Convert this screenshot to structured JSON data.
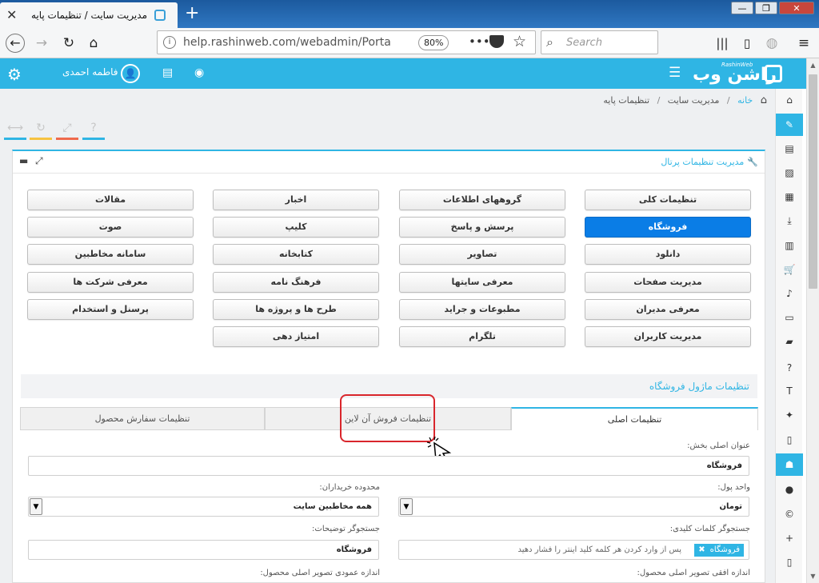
{
  "browser": {
    "tab_title": "مدیریت سایت / تنظیمات پایه",
    "tab_close": "✕",
    "new_tab": "+",
    "url": "help.rashinweb.com/webadmin/Portal_Co",
    "zoom": "80%",
    "search_placeholder": "Search",
    "window_buttons": [
      "—",
      "❐",
      "✕"
    ]
  },
  "header": {
    "user_name": "فاطمه احمدی",
    "logo_text": "راشن وب",
    "logo_sub": "RashinWeb"
  },
  "breadcrumb": {
    "home": "خانه",
    "items": [
      "مدیریت سایت",
      "تنظیمات پایه"
    ]
  },
  "panel": {
    "title": "مدیریت تنظیمات پرتال"
  },
  "modules": [
    {
      "label": "تنظیمات کلی",
      "active": false
    },
    {
      "label": "گروههای اطلاعات",
      "active": false
    },
    {
      "label": "اخبار",
      "active": false
    },
    {
      "label": "مقالات",
      "active": false
    },
    {
      "label": "فروشگاه",
      "active": true
    },
    {
      "label": "پرسش و پاسخ",
      "active": false
    },
    {
      "label": "کلیپ",
      "active": false
    },
    {
      "label": "صوت",
      "active": false
    },
    {
      "label": "دانلود",
      "active": false
    },
    {
      "label": "تصاویر",
      "active": false
    },
    {
      "label": "کتابخانه",
      "active": false
    },
    {
      "label": "سامانه مخاطبین",
      "active": false
    },
    {
      "label": "مدیریت صفحات",
      "active": false
    },
    {
      "label": "معرفی سایتها",
      "active": false
    },
    {
      "label": "فرهنگ نامه",
      "active": false
    },
    {
      "label": "معرفی شرکت ها",
      "active": false
    },
    {
      "label": "معرفی مدیران",
      "active": false
    },
    {
      "label": "مطبوعات و جراید",
      "active": false
    },
    {
      "label": "طرح ها و پروژه ها",
      "active": false
    },
    {
      "label": "پرسنل و استخدام",
      "active": false
    },
    {
      "label": "مدیریت کاربران",
      "active": false
    },
    {
      "label": "تلگرام",
      "active": false
    },
    {
      "label": "امتیاز دهی",
      "active": false
    }
  ],
  "section": {
    "title": "تنظیمات ماژول فروشگاه"
  },
  "tabs": [
    {
      "label": "تنظیمات اصلی",
      "active": true
    },
    {
      "label": "تنظیمات فروش آن لاین",
      "active": false
    },
    {
      "label": "تنظیمات سفارش محصول",
      "active": false
    }
  ],
  "form": {
    "section_title_label": "عنوان اصلی بخش:",
    "section_title_value": "فروشگاه",
    "currency_label": "واحد پول:",
    "currency_value": "تومان",
    "buyers_label": "محدوده خریداران:",
    "buyers_value": "همه مخاطبین سایت",
    "keyword_search_label": "جستجوگر کلمات کلیدی:",
    "keyword_tag": "فروشگاه",
    "keyword_tag_remove": "✖",
    "keyword_hint": "پس از وارد کردن هر کلمه کلید اینتر را فشار دهید",
    "desc_search_label": "جستجوگر توضیحات:",
    "desc_search_value": "فروشگاه",
    "img_width_label": "اندازه افقی تصویر اصلی محصول:",
    "img_height_label": "اندازه عمودی تصویر اصلی محصول:"
  },
  "colors": {
    "accent": "#2fb5e4",
    "active_button": "#0a7de6",
    "highlight": "#d9262c"
  },
  "icons": {
    "sidebar": [
      "home-icon",
      "pencil-icon",
      "news-icon",
      "image-icon",
      "document-icon",
      "download-icon",
      "film-icon",
      "cart-icon",
      "audio-icon",
      "monitor-icon",
      "book-icon",
      "question-icon",
      "text-icon",
      "pin-icon",
      "file-icon",
      "shop-icon",
      "user-icon",
      "copyright-icon",
      "add-user-icon",
      "mobile-icon"
    ]
  }
}
